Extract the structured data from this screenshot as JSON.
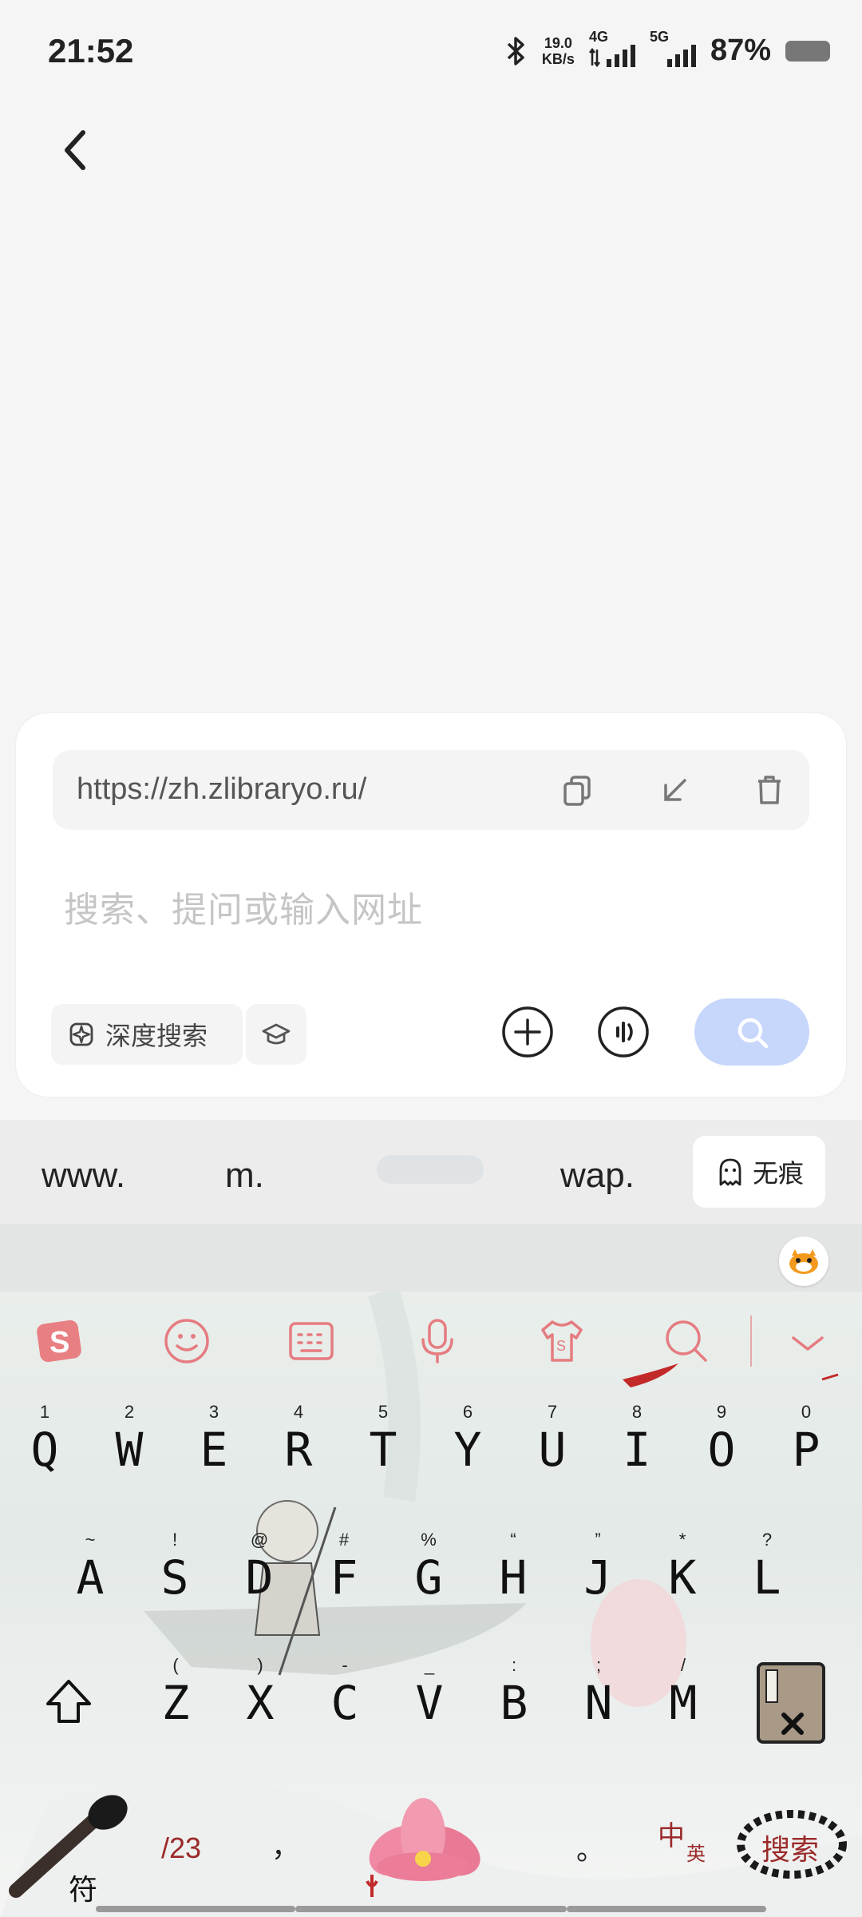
{
  "status_bar": {
    "time": "21:52",
    "net_speed_value": "19.0",
    "net_speed_unit": "KB/s",
    "signal_1_label": "4G",
    "signal_2_label": "5G",
    "battery": "87%"
  },
  "search_panel": {
    "url": "https://zh.zlibraryo.ru/",
    "query_placeholder": "搜索、提问或输入网址",
    "deep_search_label": "深度搜索",
    "accent_color": "#c7d6fb"
  },
  "suggestions": {
    "items": [
      "www.",
      "m.",
      "wap."
    ],
    "incognito_label": "无痕"
  },
  "keyboard": {
    "row1": [
      {
        "main": "Q",
        "sub": "1"
      },
      {
        "main": "W",
        "sub": "2"
      },
      {
        "main": "E",
        "sub": "3"
      },
      {
        "main": "R",
        "sub": "4"
      },
      {
        "main": "T",
        "sub": "5"
      },
      {
        "main": "Y",
        "sub": "6"
      },
      {
        "main": "U",
        "sub": "7"
      },
      {
        "main": "I",
        "sub": "8"
      },
      {
        "main": "O",
        "sub": "9"
      },
      {
        "main": "P",
        "sub": "0"
      }
    ],
    "row2": [
      {
        "main": "A",
        "sub": "~"
      },
      {
        "main": "S",
        "sub": "!"
      },
      {
        "main": "D",
        "sub": "@"
      },
      {
        "main": "F",
        "sub": "#"
      },
      {
        "main": "G",
        "sub": "%"
      },
      {
        "main": "H",
        "sub": "“"
      },
      {
        "main": "J",
        "sub": "”"
      },
      {
        "main": "K",
        "sub": "*"
      },
      {
        "main": "L",
        "sub": "?"
      }
    ],
    "row3": [
      {
        "main": "Z",
        "sub": "("
      },
      {
        "main": "X",
        "sub": ")"
      },
      {
        "main": "C",
        "sub": "-"
      },
      {
        "main": "V",
        "sub": "_"
      },
      {
        "main": "B",
        "sub": ":"
      },
      {
        "main": "N",
        "sub": ";"
      },
      {
        "main": "M",
        "sub": "/"
      }
    ],
    "symbol_key": "符",
    "num_key": "/23",
    "comma_key": "，",
    "period_key": "。",
    "lang_key_zh": "中",
    "lang_key_en": "英",
    "search_key": "搜索"
  }
}
